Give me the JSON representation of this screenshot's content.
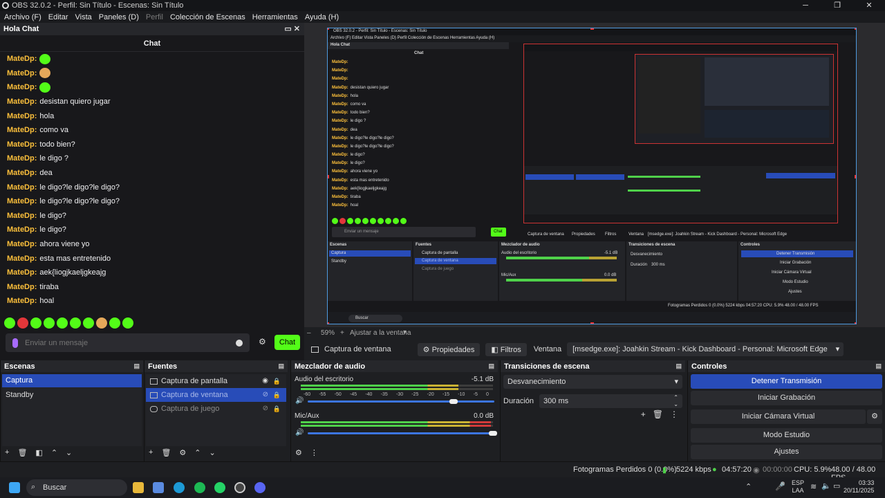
{
  "window": {
    "title": "OBS 32.0.2 - Perfil: Sin Título - Escenas: Sin Título",
    "controls": [
      "─",
      "❐",
      "✕"
    ]
  },
  "menu": [
    "Archivo (F)",
    "Editar",
    "Vista",
    "Paneles (D)",
    "Perfil",
    "Colección de Escenas",
    "Herramientas",
    "Ayuda (H)"
  ],
  "chat_dock": {
    "dock_title": "Hola Chat",
    "title": "Chat",
    "messages": [
      {
        "user": "MateDp:",
        "text": "",
        "emote": "green"
      },
      {
        "user": "MateDp:",
        "text": "",
        "emote": "face"
      },
      {
        "user": "MateDp:",
        "text": "",
        "emote": "green"
      },
      {
        "user": "MateDp:",
        "text": "desistan quiero jugar"
      },
      {
        "user": "MateDp:",
        "text": "hola"
      },
      {
        "user": "MateDp:",
        "text": "como va"
      },
      {
        "user": "MateDp:",
        "text": "todo bien?"
      },
      {
        "user": "MateDp:",
        "text": "le digo ?"
      },
      {
        "user": "MateDp:",
        "text": "dea"
      },
      {
        "user": "MateDp:",
        "text": "le digo?le digo?le digo?"
      },
      {
        "user": "MateDp:",
        "text": "le digo?le digo?le digo?"
      },
      {
        "user": "MateDp:",
        "text": "le digo?"
      },
      {
        "user": "MateDp:",
        "text": "le digo?"
      },
      {
        "user": "MateDp:",
        "text": "ahora viene yo"
      },
      {
        "user": "MateDp:",
        "text": "esta mas entretenido"
      },
      {
        "user": "MateDp:",
        "text": "aek{liogjkaeljgkeajg"
      },
      {
        "user": "MateDp:",
        "text": "tiraba"
      },
      {
        "user": "MateDp:",
        "text": "hoal"
      }
    ],
    "input_placeholder": "Enviar un mensaje",
    "send_label": "Chat"
  },
  "zoom": {
    "value": "59%",
    "fit_label": "Ajustar a la ventana"
  },
  "source_toolbar": {
    "source_name": "Captura de ventana",
    "properties_label": "Propiedades",
    "filters_label": "Filtros",
    "window_label": "Ventana",
    "window_value": "[msedge.exe]: Joahkin Stream - Kick Dashboard - Personal: Microsoft Edge"
  },
  "scenes": {
    "title": "Escenas",
    "items": [
      "Captura",
      "Standby"
    ]
  },
  "sources": {
    "title": "Fuentes",
    "items": [
      "Captura de pantalla",
      "Captura de ventana",
      "Captura de juego"
    ]
  },
  "mixer": {
    "title": "Mezclador de audio",
    "channels": [
      {
        "name": "Audio del escritorio",
        "db": "-5.1 dB",
        "level": 0.82
      },
      {
        "name": "Mic/Aux",
        "db": "0.0 dB",
        "level": 0.99
      }
    ],
    "scale": [
      "-60",
      "-55",
      "-50",
      "-45",
      "-40",
      "-35",
      "-30",
      "-25",
      "-20",
      "-15",
      "-10",
      "-5",
      "0"
    ]
  },
  "transitions": {
    "title": "Transiciones de escena",
    "selected": "Desvanecimiento",
    "duration_label": "Duración",
    "duration_value": "300 ms"
  },
  "controls": {
    "title": "Controles",
    "buttons": [
      "Detener Transmisión",
      "Iniciar Grabación",
      "Iniciar Cámara Virtual",
      "Modo Estudio",
      "Ajustes"
    ]
  },
  "status": {
    "dropped": "Fotogramas Perdidos 0 (0.0%)",
    "bitrate": "5224 kbps",
    "stream_time": "04:57:20",
    "rec_time": "00:00:00",
    "cpu": "CPU: 5.9%",
    "fps": "48.00 / 48.00 FPS"
  },
  "taskbar": {
    "search": "Buscar",
    "lang": "ESP",
    "lang2": "LAA",
    "time": "03:33",
    "date": "20/11/2025"
  },
  "preview_mini": {
    "title": "OBS 32.0.2 - Perfil: Sin Título - Escenas: Sin Título",
    "menu": "Archivo (F)   Editar   Vista   Paneles (D)   Perfil   Colección de Escenas   Herramientas   Ayuda (H)",
    "dock_title": "Hola Chat",
    "chat_title": "Chat",
    "messages": [
      "",
      "",
      "",
      "desistan quiero jugar",
      "hola",
      "como va",
      "todo bien?",
      "le digo ?",
      "dea",
      "le digo?le digo?le digo?",
      "le digo?le digo?le digo?",
      "le digo?",
      "le digo?",
      "ahora viene yo",
      "esta mas entretenido",
      "aek{liogjkaeljgkeajg",
      "tiraba",
      "hoal"
    ],
    "user": "MateDp:",
    "input": "Enviar un mensaje",
    "send": "Chat",
    "source": "Captura de ventana",
    "props": "Propiedades",
    "filters": "Filtros",
    "window_label": "Ventana",
    "window_value": "[msedge.exe]: Joahkin Stream - Kick Dashboard - Personal: Microsoft Edge",
    "scenes_title": "Escenas",
    "sources_title": "Fuentes",
    "mixer_title": "Mezclador de audio",
    "trans_title": "Transiciones de escena",
    "controls_title": "Controles",
    "scene1": "Captura",
    "scene2": "Standby",
    "src1": "Captura de pantalla",
    "src2": "Captura de ventana",
    "src3": "Captura de juego",
    "ch1": "Audio del escritorio",
    "ch1db": "-5.1 dB",
    "ch2": "Mic/Aux",
    "ch2db": "0.0 dB",
    "trans": "Desvanecimiento",
    "dur_label": "Duración",
    "dur": "300 ms",
    "btn1": "Detener Transmisión",
    "btn2": "Iniciar Grabación",
    "btn3": "Iniciar Cámara Virtual",
    "btn4": "Modo Estudio",
    "btn5": "Ajustes",
    "status": "Fotogramas Perdidos 0 (0.0%)   5224 kbps   04:57:20   CPU: 5.9%   48.00 / 48.00 FPS",
    "search": "Buscar",
    "zoom": "59%",
    "fit": "Ajustar a la ventana"
  },
  "colors": {
    "accent": "#284cb8",
    "kick_green": "#53fc18",
    "username": "#fdc03b",
    "selection_border": "#4f9be0"
  }
}
